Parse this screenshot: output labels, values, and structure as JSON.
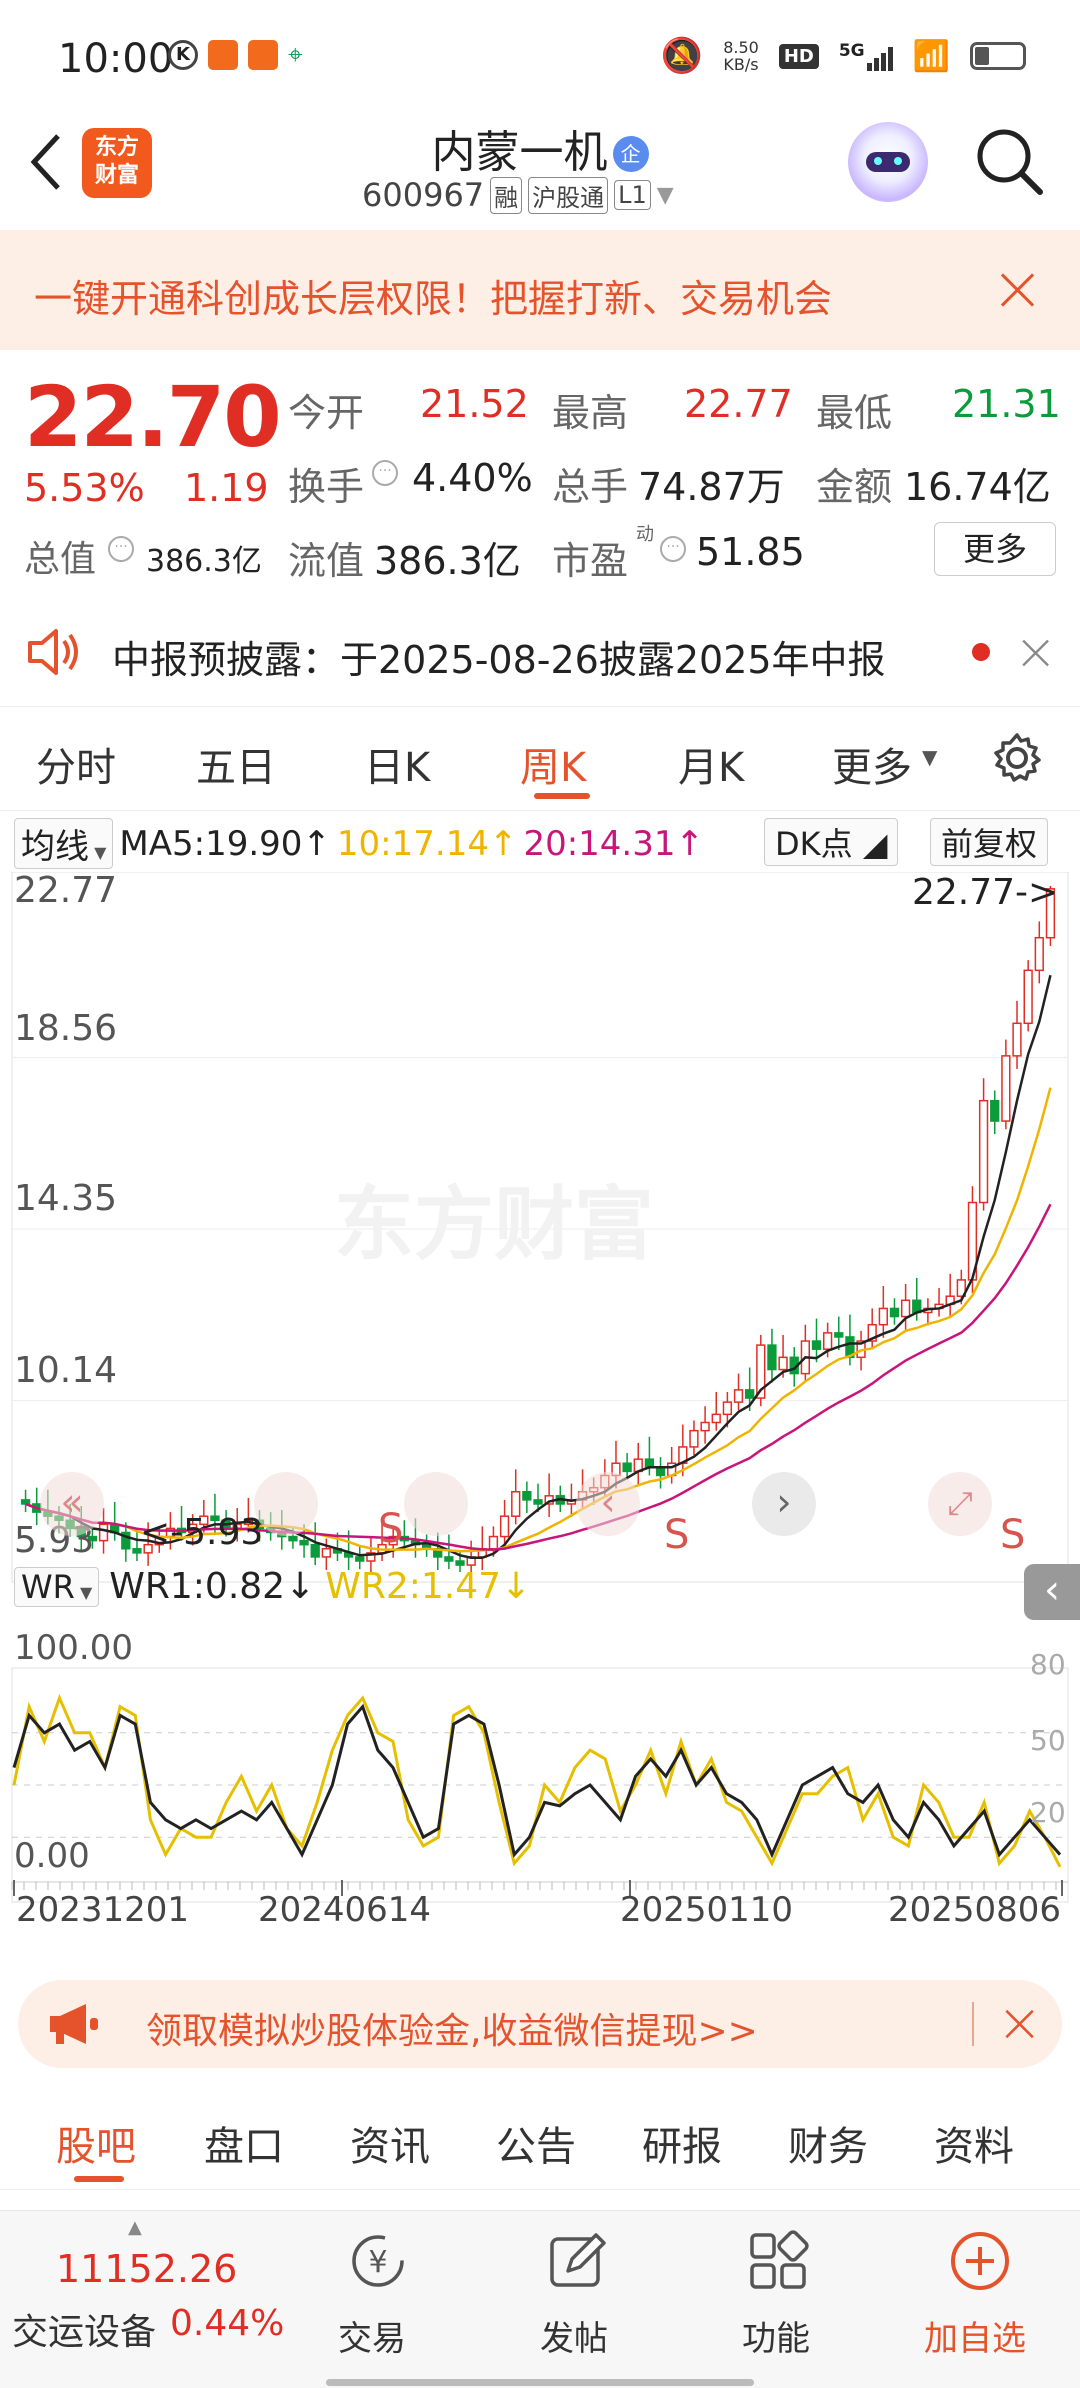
{
  "status": {
    "time": "10:00",
    "speed": "8.50\nKB/s",
    "speed_top": "8.50",
    "speed_bot": "KB/s",
    "hd": "HD",
    "net": "5G"
  },
  "header": {
    "logo_line1": "东方",
    "logo_line2": "财富",
    "title": "内蒙一机",
    "badge": "企",
    "code": "600967",
    "tag1": "融",
    "tag2": "沪股通",
    "tag3": "L1"
  },
  "banner": {
    "text": "一键开通科创成长层权限！把握打新、交易机会"
  },
  "quote": {
    "price": "22.70",
    "change_pct": "5.53%",
    "change": "1.19",
    "open_label": "今开",
    "open": "21.52",
    "high_label": "最高",
    "high": "22.77",
    "low_label": "最低",
    "low": "21.31",
    "turnover_label": "换手",
    "turnover": "4.40%",
    "volume_label": "总手",
    "volume": "74.87万",
    "amount_label": "金额",
    "amount": "16.74亿",
    "mktcap_label": "总值",
    "mktcap": "386.3亿",
    "float_label": "流值",
    "float_cap": "386.3亿",
    "pe_label": "市盈",
    "pe_sup": "动",
    "pe": "51.85",
    "more": "更多"
  },
  "notice": {
    "text": "中报预披露：于2025-08-26披露2025年中报"
  },
  "tabs": [
    "分时",
    "五日",
    "日K",
    "周K",
    "月K",
    "更多"
  ],
  "active_tab": "周K",
  "chart": {
    "ma_selector": "均线",
    "ma5": "MA5:19.90↑",
    "ma10": "10:17.14↑",
    "ma20": "20:14.31↑",
    "dk": "DK点",
    "fq": "前复权",
    "y_labels": [
      "22.77",
      "18.56",
      "14.35",
      "10.14",
      "5.93"
    ],
    "max_marker": "22.77->",
    "min_marker": "<-5.93",
    "watermark": "东方财富",
    "s_marks": [
      "S",
      "S",
      "S"
    ],
    "ind_selector": "WR",
    "wr1": "WR1:0.82↓",
    "wr2": "WR2:1.47↓",
    "ind_y": [
      "100.00",
      "0.00"
    ],
    "ind_right": [
      "80",
      "50",
      "20"
    ],
    "dates": [
      "20231201",
      "20240614",
      "20250110",
      "20250806"
    ],
    "colors": {
      "up": "#e02e24",
      "down": "#0a9b3a",
      "ma5": "#222222",
      "ma10": "#f0b400",
      "ma20": "#c8157a",
      "wr1": "#222222",
      "wr2": "#e6c000"
    }
  },
  "chart_data": {
    "type": "candlestick",
    "ylim": [
      5.93,
      22.77
    ],
    "closes": [
      7.6,
      7.4,
      7.3,
      7.2,
      7.0,
      6.8,
      6.7,
      7.1,
      6.9,
      6.5,
      6.4,
      6.6,
      6.8,
      7.0,
      6.9,
      7.1,
      7.3,
      7.2,
      7.0,
      7.1,
      7.2,
      7.0,
      6.9,
      6.8,
      6.7,
      6.6,
      6.3,
      6.5,
      6.4,
      6.3,
      6.2,
      6.4,
      6.6,
      6.8,
      6.7,
      6.6,
      6.5,
      6.3,
      6.2,
      6.1,
      6.3,
      6.5,
      6.8,
      7.3,
      7.9,
      7.7,
      7.6,
      7.8,
      7.6,
      7.7,
      7.9,
      8.0,
      8.3,
      8.6,
      8.4,
      8.7,
      8.5,
      8.3,
      8.6,
      9.0,
      9.4,
      9.6,
      9.8,
      10.1,
      10.4,
      10.2,
      11.5,
      10.9,
      11.2,
      10.8,
      11.6,
      11.4,
      11.8,
      11.7,
      11.2,
      11.6,
      12.0,
      12.4,
      12.2,
      12.6,
      12.3,
      12.4,
      12.5,
      12.7,
      13.1,
      15.0,
      17.5,
      17.0,
      18.6,
      19.4,
      20.7,
      21.5,
      22.7
    ],
    "ma5_last": 19.9,
    "ma10_last": 17.14,
    "ma20_last": 14.31,
    "wr1": [
      60,
      90,
      80,
      85,
      70,
      75,
      60,
      90,
      85,
      40,
      30,
      25,
      30,
      25,
      30,
      35,
      30,
      40,
      25,
      10,
      30,
      50,
      85,
      95,
      70,
      60,
      40,
      20,
      25,
      85,
      90,
      85,
      50,
      10,
      20,
      40,
      38,
      45,
      50,
      40,
      30,
      55,
      65,
      55,
      70,
      50,
      60,
      45,
      40,
      30,
      10,
      30,
      50,
      55,
      60,
      45,
      40,
      50,
      30,
      20,
      40,
      30,
      15,
      25,
      35,
      10,
      20,
      30,
      20,
      10
    ],
    "wr2": [
      50,
      95,
      75,
      100,
      80,
      80,
      60,
      95,
      90,
      30,
      10,
      25,
      20,
      20,
      40,
      55,
      35,
      50,
      25,
      15,
      40,
      70,
      90,
      100,
      80,
      75,
      30,
      15,
      20,
      90,
      95,
      80,
      40,
      5,
      15,
      50,
      40,
      60,
      70,
      65,
      35,
      50,
      70,
      45,
      75,
      50,
      65,
      40,
      35,
      20,
      5,
      25,
      45,
      45,
      55,
      60,
      30,
      45,
      20,
      15,
      50,
      40,
      20,
      20,
      40,
      5,
      15,
      35,
      20,
      3
    ],
    "wr1_last": 0.82,
    "wr2_last": 1.47
  },
  "promo": {
    "text": "领取模拟炒股体验金,收益微信提现>>"
  },
  "subtabs": [
    "股吧",
    "盘口",
    "资讯",
    "公告",
    "研报",
    "财务",
    "资料"
  ],
  "active_subtab": "股吧",
  "bottom": {
    "index_value": "11152.26",
    "index_name": "交运设备",
    "index_pct": "0.44%",
    "trade": "交易",
    "post": "发帖",
    "func": "功能",
    "add": "加自选"
  }
}
